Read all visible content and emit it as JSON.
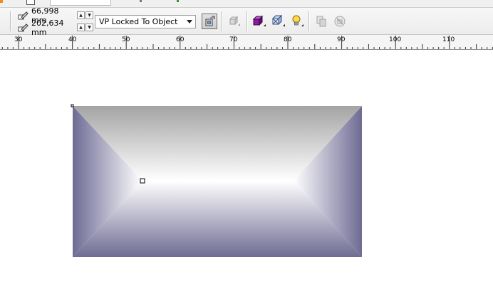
{
  "property_bar": {
    "width_value": "66,998 mm",
    "height_value": "202,634 mm",
    "vanishing_point_mode": "VP Locked To Object",
    "icons": {
      "width_icon": "pencil-width-icon",
      "height_icon": "pencil-height-icon",
      "vp_button": "vanishing-point-toggle-icon",
      "copy_extrude": "copy-extrude-properties-icon",
      "color": "extrude-color-cube-icon",
      "bevel": "extrude-bevel-icon",
      "lighting": "lightbulb-lighting-icon",
      "convert": "convert-extrude-icon",
      "clear": "clear-extrude-icon"
    }
  },
  "ruler": {
    "labels": [
      "30",
      "40",
      "50",
      "60",
      "70",
      "80",
      "90",
      "100",
      "110"
    ]
  },
  "canvas": {
    "object": "extruded-rectangle",
    "colors": {
      "top_face": "#a6a6a6",
      "center_light": "#ffffff",
      "side_face_dark": "#6e6b94",
      "bottom_face_dark": "#6f6c93"
    }
  }
}
